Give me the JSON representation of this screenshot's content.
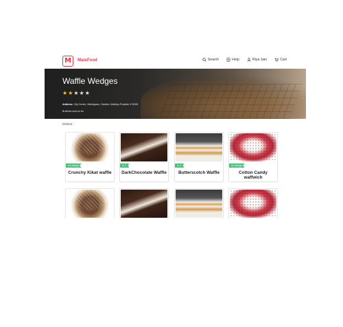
{
  "brand": {
    "name": "MarsFood",
    "logo_letter": "M"
  },
  "nav": {
    "search": "Search",
    "help": "Help",
    "user": "Riya Jain",
    "cart": "Cart"
  },
  "restaurant": {
    "name": "Waffle Wedges",
    "rating_stars": 2,
    "rating_max": 5,
    "address_label": "Address:",
    "address": "City Center, Mahalgaon, Gwalior, Madhya Pradesh 474005",
    "served_count": "3",
    "served_text": "dishes sold so far"
  },
  "dishes_label": "Dishes :",
  "dishes": [
    {
      "name": "Crunchy Kikat waffle",
      "badge": "no ratings"
    },
    {
      "name": "DarkChocolate Waffle",
      "badge": "★ 2"
    },
    {
      "name": "Butterscotch Waffle",
      "badge": "★ 3"
    },
    {
      "name": "Cotton Candy waffwich",
      "badge": "no ratings"
    }
  ],
  "colors": {
    "brand": "#e23744",
    "badge": "#48c479",
    "star": "#f5c518"
  },
  "icons": {
    "search": "search-icon",
    "help": "help-icon",
    "user": "user-icon",
    "cart": "cart-icon"
  }
}
